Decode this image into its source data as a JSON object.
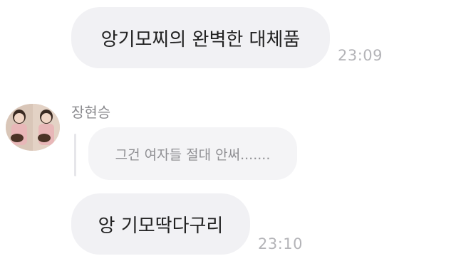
{
  "messages": [
    {
      "text": "앙기모찌의 완벽한 대체품",
      "time": "23:09"
    },
    {
      "sender": "장현승",
      "quote": "그건 여자들 절대 안써......."
    },
    {
      "text": "앙 기모딱다구리",
      "time": "23:10"
    }
  ],
  "colors": {
    "bubble": "#f1f1f4",
    "quote_bubble": "#f4f4f6",
    "time_text": "#b4b4b8",
    "sender_text": "#8a8a8e"
  }
}
